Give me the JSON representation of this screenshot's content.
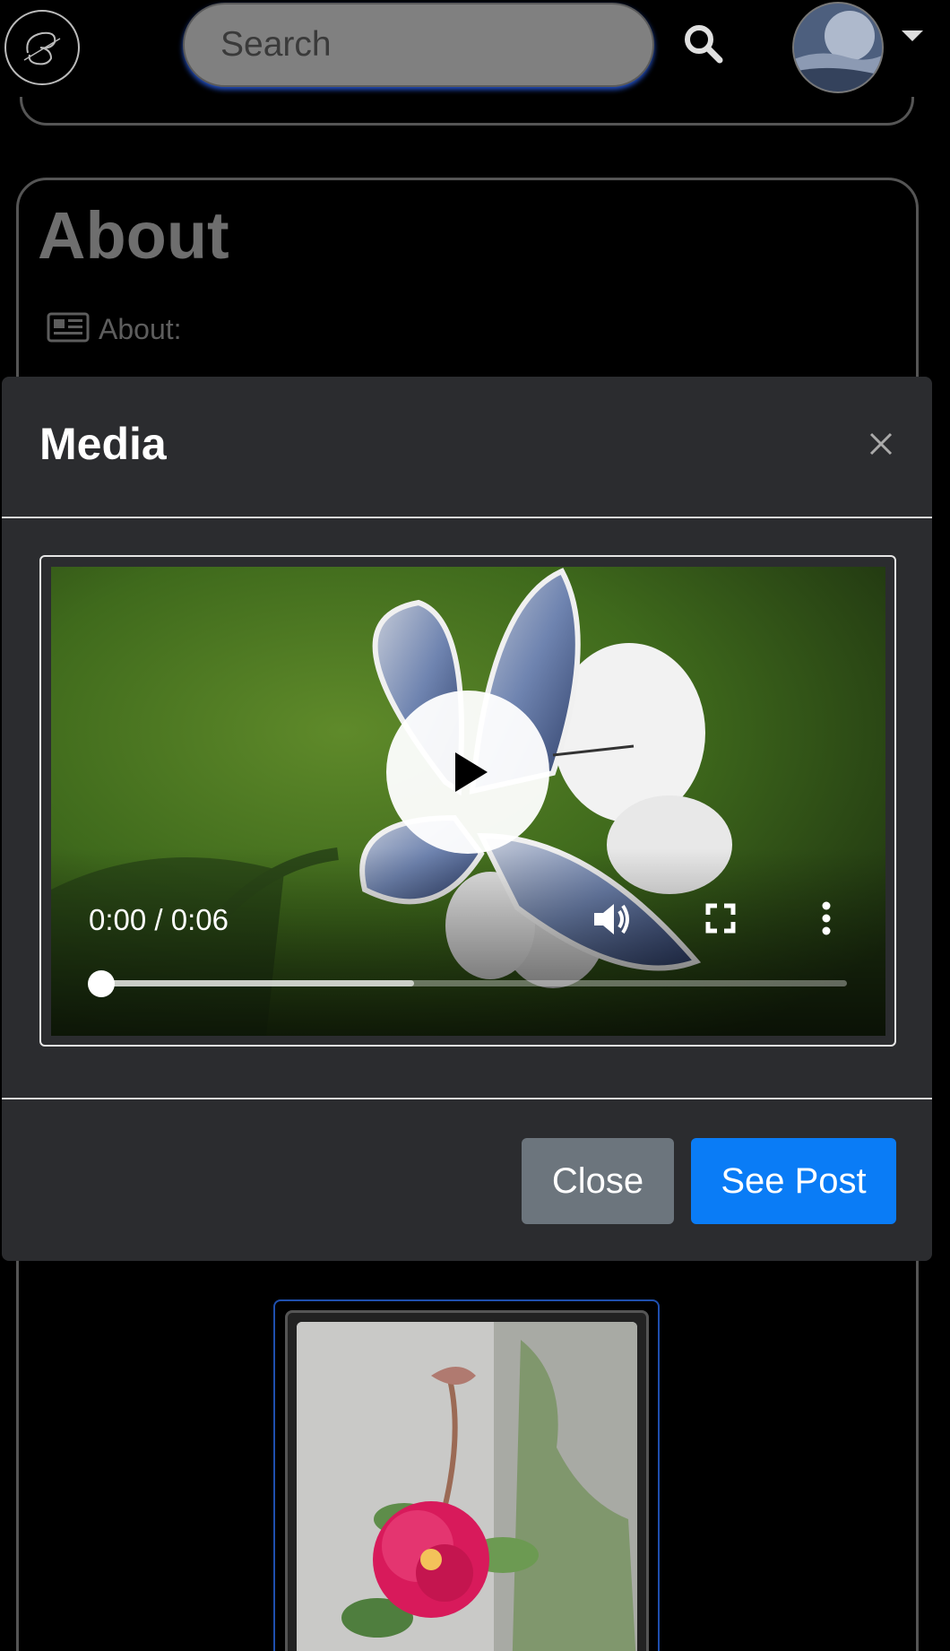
{
  "navbar": {
    "search_placeholder": "Search",
    "logo_icon": "monogram-logo-icon",
    "search_icon": "search-icon",
    "profile_icon": "avatar",
    "menu_icon": "caret-down-icon"
  },
  "about": {
    "title": "About",
    "label": "About:",
    "icon": "newspaper-icon"
  },
  "modal": {
    "title": "Media",
    "close_icon": "close-icon",
    "video": {
      "time": "0:00 / 0:06",
      "progress": 0,
      "buffered": 0.42,
      "controls": [
        "play-icon",
        "volume-icon",
        "fullscreen-icon",
        "more-options-icon"
      ]
    },
    "buttons": {
      "close_label": "Close",
      "see_post_label": "See Post"
    }
  },
  "colors": {
    "background": "#000000",
    "modal_background": "#2b2c2f",
    "primary_button": "#0a7cf6",
    "secondary_button": "#6c757d",
    "search_glow": "#285adc"
  }
}
